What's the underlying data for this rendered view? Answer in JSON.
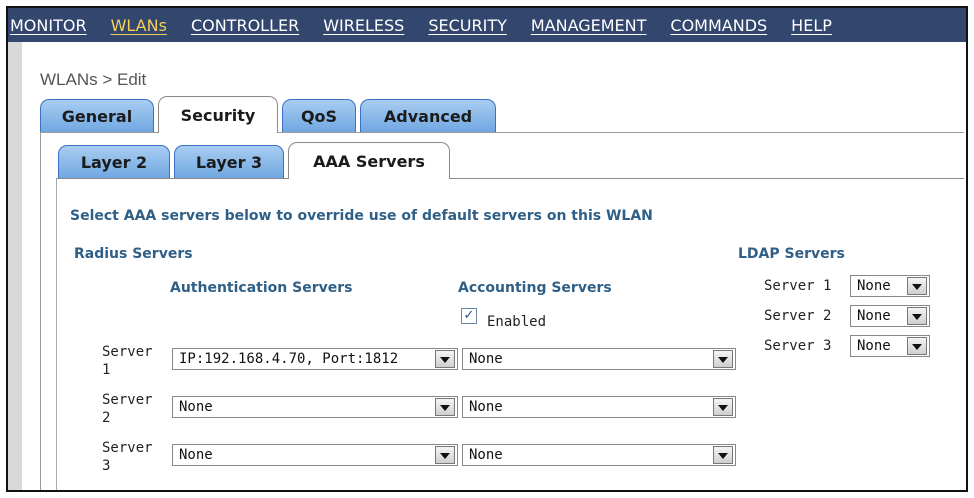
{
  "nav": [
    {
      "label": "MONITOR",
      "active": false
    },
    {
      "label": "WLANs",
      "active": true
    },
    {
      "label": "CONTROLLER",
      "active": false
    },
    {
      "label": "WIRELESS",
      "active": false
    },
    {
      "label": "SECURITY",
      "active": false
    },
    {
      "label": "MANAGEMENT",
      "active": false
    },
    {
      "label": "COMMANDS",
      "active": false
    },
    {
      "label": "HELP",
      "active": false
    }
  ],
  "breadcrumb": "WLANs > Edit",
  "tabs": [
    "General",
    "Security",
    "QoS",
    "Advanced"
  ],
  "subtabs": [
    "Layer 2",
    "Layer 3",
    "AAA Servers"
  ],
  "description": "Select AAA servers below to override use of default servers on this WLAN",
  "radius": {
    "heading": "Radius Servers",
    "auth_heading": "Authentication Servers",
    "acct_heading": "Accounting Servers",
    "enabled_label": "Enabled",
    "enabled_checked": true,
    "rows": [
      {
        "label1": "Server",
        "label2": "1",
        "auth": "IP:192.168.4.70, Port:1812",
        "acct": "None"
      },
      {
        "label1": "Server",
        "label2": "2",
        "auth": "None",
        "acct": "None"
      },
      {
        "label1": "Server",
        "label2": "3",
        "auth": "None",
        "acct": "None"
      }
    ]
  },
  "ldap": {
    "heading": "LDAP Servers",
    "servers": [
      {
        "label": "Server 1",
        "value": "None"
      },
      {
        "label": "Server 2",
        "value": "None"
      },
      {
        "label": "Server 3",
        "value": "None"
      }
    ]
  },
  "colors": {
    "nav_bg": "#33466e",
    "nav_active": "#f3cf5a",
    "tab_blue": "#6fa6e2",
    "heading_blue": "#2f5f86"
  }
}
